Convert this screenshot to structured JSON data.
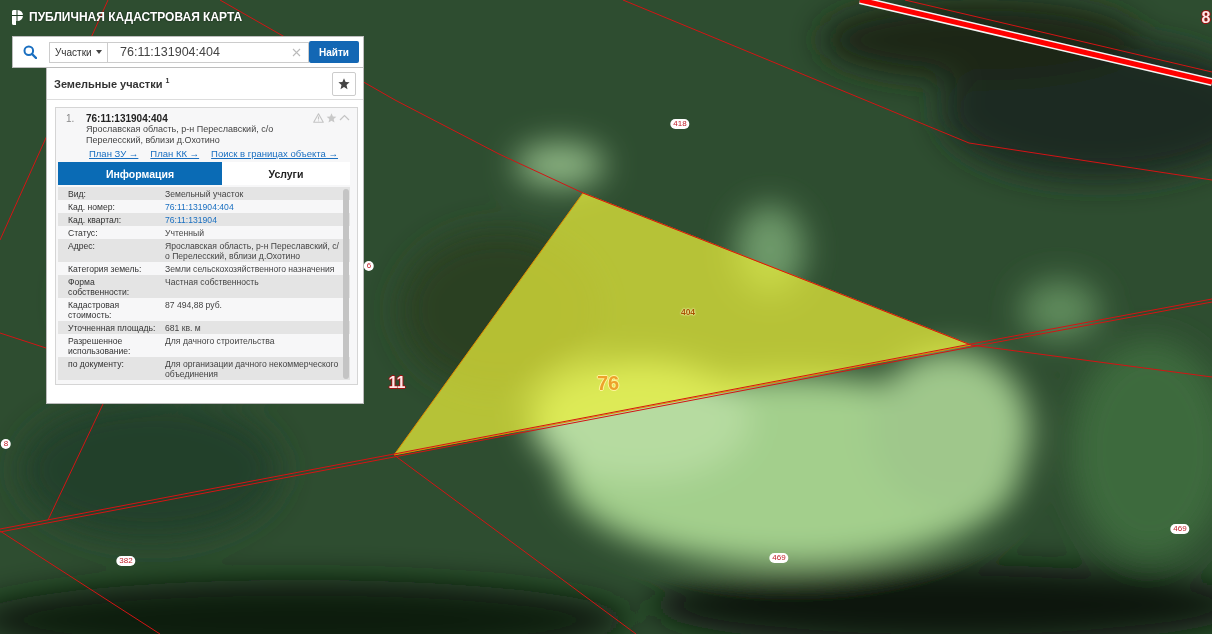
{
  "header": {
    "title": "ПУБЛИЧНАЯ КАДАСТРОВАЯ КАРТА"
  },
  "search": {
    "category": "Участки",
    "value": "76:11:131904:404",
    "button": "Найти"
  },
  "results": {
    "title": "Земельные участки $^{1}$",
    "items": [
      {
        "index": "1.",
        "number": "76:11:131904:404",
        "address": "Ярославская область, р-н Переславский, с/о Перелесский, вблизи д.Охотино",
        "expanded": true,
        "links": [
          "План ЗУ →",
          "План КК →",
          "Поиск в границах объекта →"
        ],
        "tabs": [
          {
            "label": "Информация",
            "selected": true
          },
          {
            "label": "Услуги",
            "selected": false
          }
        ],
        "fields": [
          {
            "label": "Вид:",
            "value": "Земельный участок",
            "kind": "text"
          },
          {
            "label": "Кад. номер:",
            "value": "76:11:131904:404",
            "kind": "link"
          },
          {
            "label": "Кад. квартал:",
            "value": "76:11:131904",
            "kind": "link"
          },
          {
            "label": "Статус:",
            "value": "Учтенный",
            "kind": "text"
          },
          {
            "label": "Адрес:",
            "value": "Ярославская область, р-н Переславский, с/о Перелесский, вблизи д.Охотино",
            "kind": "text"
          },
          {
            "label": "Категория земель:",
            "value": "Земли сельскохозяйственного назначения",
            "kind": "text"
          },
          {
            "label": "Форма собственности:",
            "value": "Частная собственность",
            "kind": "text"
          },
          {
            "label": "Кадастровая стоимость:",
            "value": "87 494,88 руб.",
            "kind": "text"
          },
          {
            "label": "Уточненная площадь:",
            "value": "681 кв. м",
            "kind": "text"
          },
          {
            "label": "Разрешенное использование:",
            "value": "Для дачного строительства",
            "kind": "text"
          },
          {
            "label": "по документу:",
            "value": "Для организации дачного некоммерческого объединения",
            "kind": "text"
          }
        ]
      }
    ]
  },
  "map": {
    "labels": [
      {
        "text": "8",
        "kind": "district"
      },
      {
        "text": "418",
        "kind": "plot"
      },
      {
        "text": "6",
        "kind": "plot"
      },
      {
        "text": "404",
        "kind": "selected-plot"
      },
      {
        "text": "11",
        "kind": "district"
      },
      {
        "text": "76",
        "kind": "quarter"
      },
      {
        "text": "8",
        "kind": "plot"
      },
      {
        "text": "469",
        "kind": "plot"
      },
      {
        "text": "469",
        "kind": "plot"
      },
      {
        "text": "382",
        "kind": "plot"
      }
    ]
  }
}
